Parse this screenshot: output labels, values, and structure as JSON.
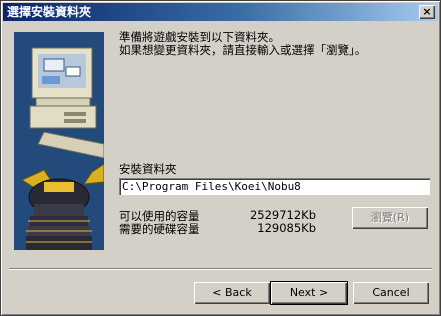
{
  "window": {
    "title": "選擇安裝資料夾",
    "close_icon": "×"
  },
  "message": {
    "line1": "準備將遊戲安裝到以下資料夾。",
    "line2": "如果想變更資料夾，請直接輸入或選擇「瀏覽」。"
  },
  "folder": {
    "label": "安裝資料夾",
    "path": "C:\\Program Files\\Koei\\Nobu8"
  },
  "space": {
    "available_label": "可以使用的容量",
    "available_value": "2529712Kb",
    "required_label": "需要的硬碟容量",
    "required_value": "129085Kb"
  },
  "buttons": {
    "browse": "瀏覽(R)",
    "back": "< Back",
    "next": "Next >",
    "cancel": "Cancel"
  },
  "colors": {
    "title_start": "#0a246a",
    "title_end": "#a6caf0",
    "face": "#d4d0c8"
  }
}
